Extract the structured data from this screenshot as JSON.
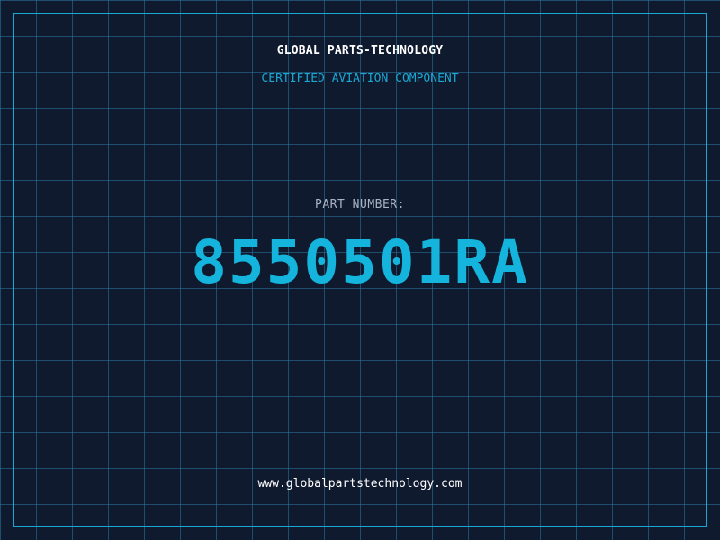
{
  "header": {
    "company": "GLOBAL PARTS-TECHNOLOGY",
    "subtitle": "CERTIFIED AVIATION COMPONENT"
  },
  "part": {
    "label": "PART NUMBER:",
    "number": "8550501RA"
  },
  "footer": {
    "website": "www.globalpartstechnology.com"
  },
  "colors": {
    "background": "#0f1a2e",
    "grid": "#2878a0",
    "accent": "#14b4dc",
    "label": "#a8b3c4",
    "text": "#ffffff"
  }
}
